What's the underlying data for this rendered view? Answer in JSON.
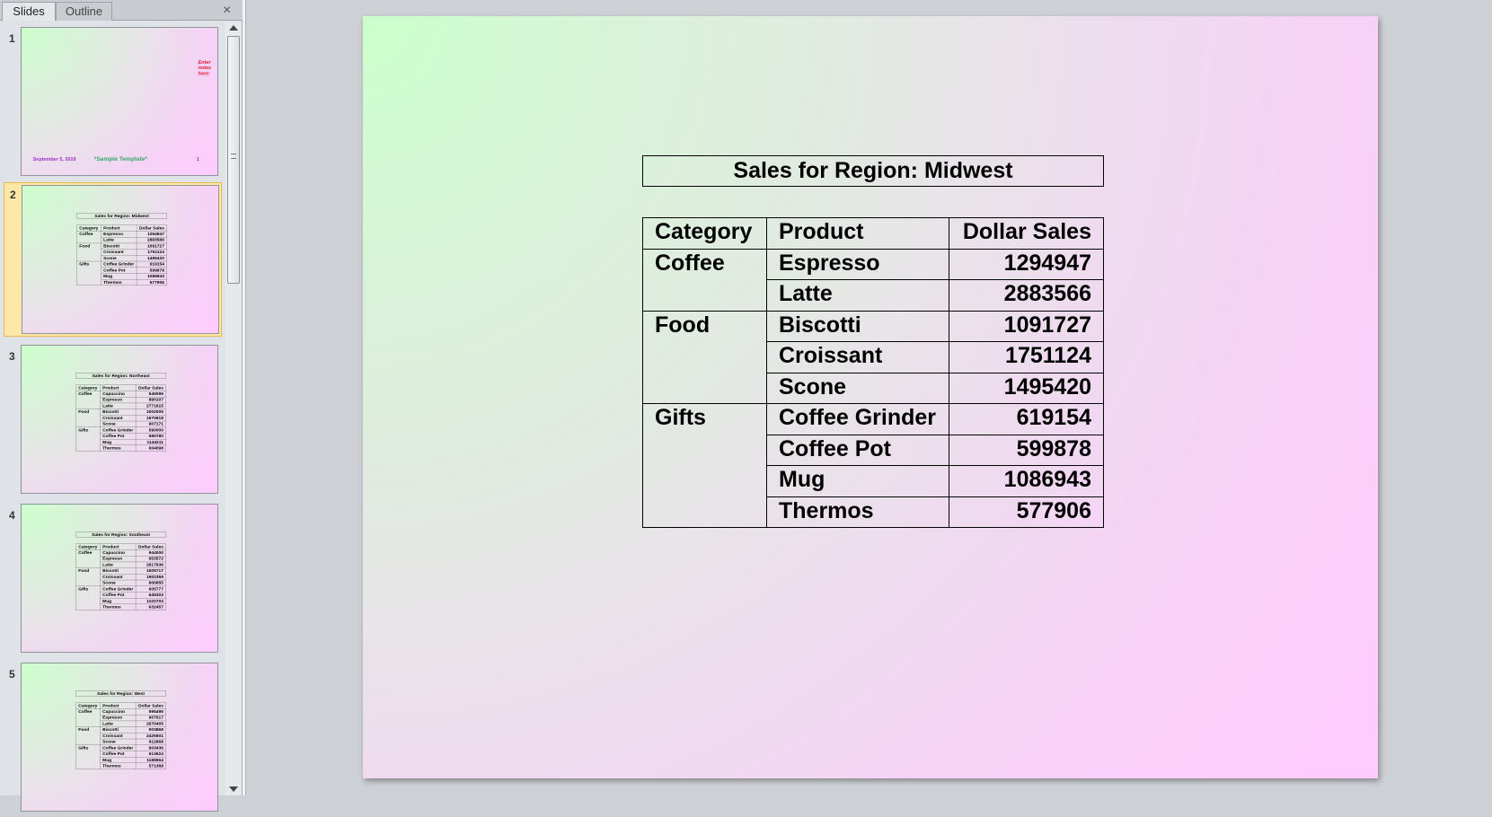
{
  "panel": {
    "tabs": [
      "Slides",
      "Outline"
    ],
    "close": "×"
  },
  "slide1": {
    "number": "1",
    "notes": "Enter notes here:",
    "date": "September 5, 2019",
    "template": "*Sample Template*",
    "page": "1"
  },
  "headers": [
    "Category",
    "Product",
    "Dollar Sales"
  ],
  "slides": [
    {
      "number": "2",
      "title": "Sales for Region: Midwest",
      "groups": [
        {
          "category": "Coffee",
          "rows": [
            [
              "Espresso",
              "1294947"
            ],
            [
              "Latte",
              "2883566"
            ]
          ]
        },
        {
          "category": "Food",
          "rows": [
            [
              "Biscotti",
              "1091727"
            ],
            [
              "Croissant",
              "1751124"
            ],
            [
              "Scone",
              "1495420"
            ]
          ]
        },
        {
          "category": "Gifts",
          "rows": [
            [
              "Coffee Grinder",
              "619154"
            ],
            [
              "Coffee Pot",
              "599878"
            ],
            [
              "Mug",
              "1086943"
            ],
            [
              "Thermos",
              "577906"
            ]
          ]
        }
      ]
    },
    {
      "number": "3",
      "title": "Sales for Region: Northeast",
      "groups": [
        {
          "category": "Coffee",
          "rows": [
            [
              "Capuccino",
              "540095"
            ],
            [
              "Espresso",
              "890107"
            ],
            [
              "Latte",
              "2771615"
            ]
          ]
        },
        {
          "category": "Food",
          "rows": [
            [
              "Biscotti",
              "1002005"
            ],
            [
              "Croissant",
              "1670818"
            ],
            [
              "Scone",
              "907171"
            ]
          ]
        },
        {
          "category": "Gifts",
          "rows": [
            [
              "Coffee Grinder",
              "590000"
            ],
            [
              "Coffee Pot",
              "590780"
            ],
            [
              "Mug",
              "1144211"
            ],
            [
              "Thermos",
              "604098"
            ]
          ]
        }
      ]
    },
    {
      "number": "4",
      "title": "Sales for Region: Southeast",
      "groups": [
        {
          "category": "Coffee",
          "rows": [
            [
              "Capuccino",
              "944000"
            ],
            [
              "Espresso",
              "653572"
            ],
            [
              "Latte",
              "2617636"
            ]
          ]
        },
        {
          "category": "Food",
          "rows": [
            [
              "Biscotti",
              "1505717"
            ],
            [
              "Croissant",
              "1902359"
            ],
            [
              "Scone",
              "800655"
            ]
          ]
        },
        {
          "category": "Gifts",
          "rows": [
            [
              "Coffee Grinder",
              "605777"
            ],
            [
              "Coffee Pot",
              "645303"
            ],
            [
              "Mug",
              "1102703"
            ],
            [
              "Thermos",
              "632457"
            ]
          ]
        }
      ]
    },
    {
      "number": "5",
      "title": "Sales for Region: West",
      "groups": [
        {
          "category": "Coffee",
          "rows": [
            [
              "Capuccino",
              "995495"
            ],
            [
              "Espresso",
              "907617"
            ],
            [
              "Latte",
              "2670405"
            ]
          ]
        },
        {
          "category": "Food",
          "rows": [
            [
              "Biscotti",
              "903868"
            ],
            [
              "Croissant",
              "2425601"
            ],
            [
              "Scone",
              "912868"
            ]
          ]
        },
        {
          "category": "Gifts",
          "rows": [
            [
              "Coffee Grinder",
              "603436"
            ],
            [
              "Coffee Pot",
              "613624"
            ],
            [
              "Mug",
              "1188664"
            ],
            [
              "Thermos",
              "571368"
            ]
          ]
        }
      ]
    }
  ],
  "current_slide_index": 0
}
